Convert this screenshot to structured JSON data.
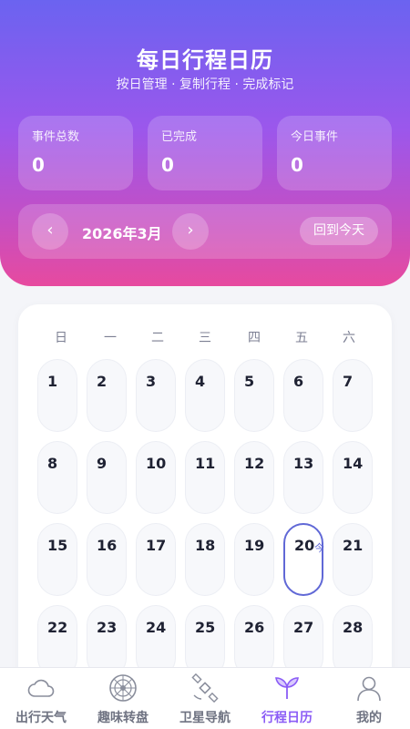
{
  "header": {
    "title": "每日行程日历",
    "subtitle": "按日管理 · 复制行程 · 完成标记"
  },
  "stats": [
    {
      "label": "事件总数",
      "value": "0"
    },
    {
      "label": "已完成",
      "value": "0"
    },
    {
      "label": "今日事件",
      "value": "0"
    }
  ],
  "month_nav": {
    "prev_icon": "chevron-left-icon",
    "next_icon": "chevron-right-icon",
    "prev_glyph": "‹",
    "next_glyph": "›",
    "month_label": "2026年3月",
    "today_button": "回到今天"
  },
  "calendar": {
    "weekdays": [
      "日",
      "一",
      "二",
      "三",
      "四",
      "五",
      "六"
    ],
    "days": [
      "1",
      "2",
      "3",
      "4",
      "5",
      "6",
      "7",
      "8",
      "9",
      "10",
      "11",
      "12",
      "13",
      "14",
      "15",
      "16",
      "17",
      "18",
      "19",
      "20",
      "21",
      "22",
      "23",
      "24",
      "25",
      "26",
      "27",
      "28"
    ],
    "today": "20",
    "today_tag": "今"
  },
  "tabs": [
    {
      "label": "出行天气",
      "icon": "cloud-icon"
    },
    {
      "label": "趣味转盘",
      "icon": "wheel-icon"
    },
    {
      "label": "卫星导航",
      "icon": "satellite-icon"
    },
    {
      "label": "行程日历",
      "icon": "sprout-icon",
      "active": true
    },
    {
      "label": "我的",
      "icon": "user-icon"
    }
  ],
  "colors": {
    "gradient_top": "#6b63f0",
    "gradient_bottom": "#e74a9f",
    "accent": "#6068d6",
    "active_tab": "#8b5cf6"
  }
}
